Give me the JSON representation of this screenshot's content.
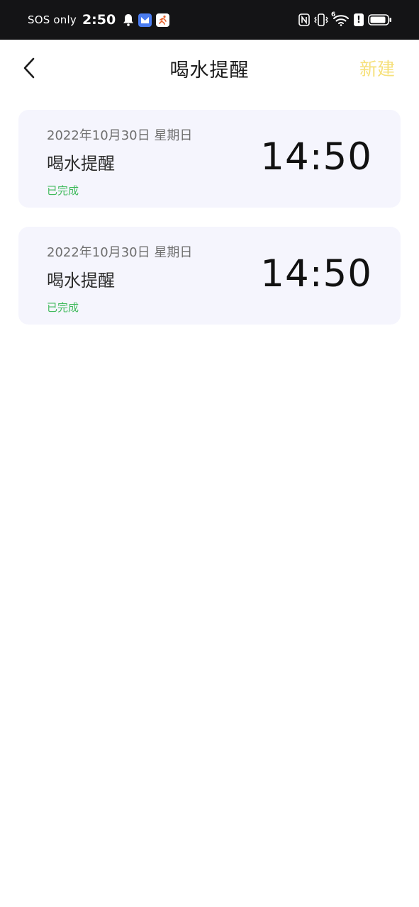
{
  "status_bar": {
    "carrier": "SOS only",
    "time": "2:50",
    "icons": [
      "bell-icon",
      "app-badge-blue",
      "app-badge-runner",
      "nfc-icon",
      "vibrate-icon",
      "wifi-icon",
      "alert-icon",
      "battery-icon"
    ],
    "wifi_label": "6",
    "alert_label": "!"
  },
  "header": {
    "title": "喝水提醒",
    "new_label": "新建",
    "back_icon": "chevron-left-icon"
  },
  "reminders": [
    {
      "date": "2022年10月30日 星期日",
      "title": "喝水提醒",
      "status": "已完成",
      "time": "14:50"
    },
    {
      "date": "2022年10月30日 星期日",
      "title": "喝水提醒",
      "status": "已完成",
      "time": "14:50"
    }
  ],
  "colors": {
    "accent_new": "#f6e07a",
    "status_done": "#3fba5c",
    "card_bg": "#f5f5fd",
    "status_bar_bg": "#141416"
  }
}
